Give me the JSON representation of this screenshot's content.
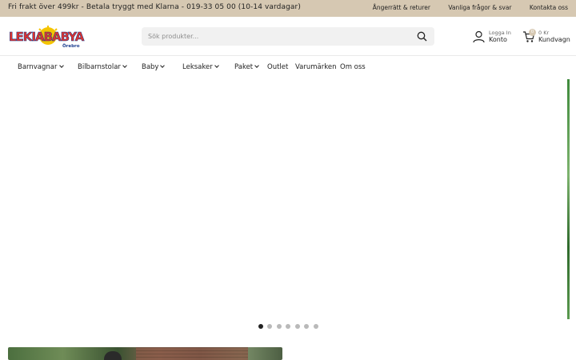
{
  "topbar": {
    "promo": "Fri frakt över 499kr - Betala tryggt med Klarna - 019-33 05 00 (10-14 vardagar)",
    "links": [
      "Ångerrätt & returer",
      "Vanliga frågor & svar",
      "Kontakta oss"
    ]
  },
  "logo": {
    "brand": "LEKIABABYA",
    "location": "Örebro",
    "colors": {
      "text": "#e5332a",
      "sun": "#f5c400",
      "outline": "#1a3d8f"
    }
  },
  "search": {
    "placeholder": "Sök produkter...",
    "value": "",
    "icon": "search-icon"
  },
  "account": {
    "small": "Logga In",
    "label": "Konto",
    "icon": "user-icon"
  },
  "cart": {
    "count": "0",
    "total": "0 Kr",
    "label": "Kundvagn",
    "icon": "cart-icon"
  },
  "nav": {
    "items": [
      {
        "label": "Barnvagnar",
        "dropdown": true
      },
      {
        "label": "Bilbarnstolar",
        "dropdown": true
      },
      {
        "label": "Baby",
        "dropdown": true
      },
      {
        "label": "Leksaker",
        "dropdown": true
      },
      {
        "label": "Paket",
        "dropdown": true
      },
      {
        "label": "Outlet",
        "dropdown": false
      },
      {
        "label": "Varumärken",
        "dropdown": false
      },
      {
        "label": "Om oss",
        "dropdown": false
      }
    ]
  },
  "carousel": {
    "slides": 7,
    "active_index": 0
  },
  "colors": {
    "topbar_bg": "#d6c8b2",
    "search_bg": "#f1f1f1",
    "dot_active": "#222222",
    "dot_inactive": "#b9b9b9"
  }
}
